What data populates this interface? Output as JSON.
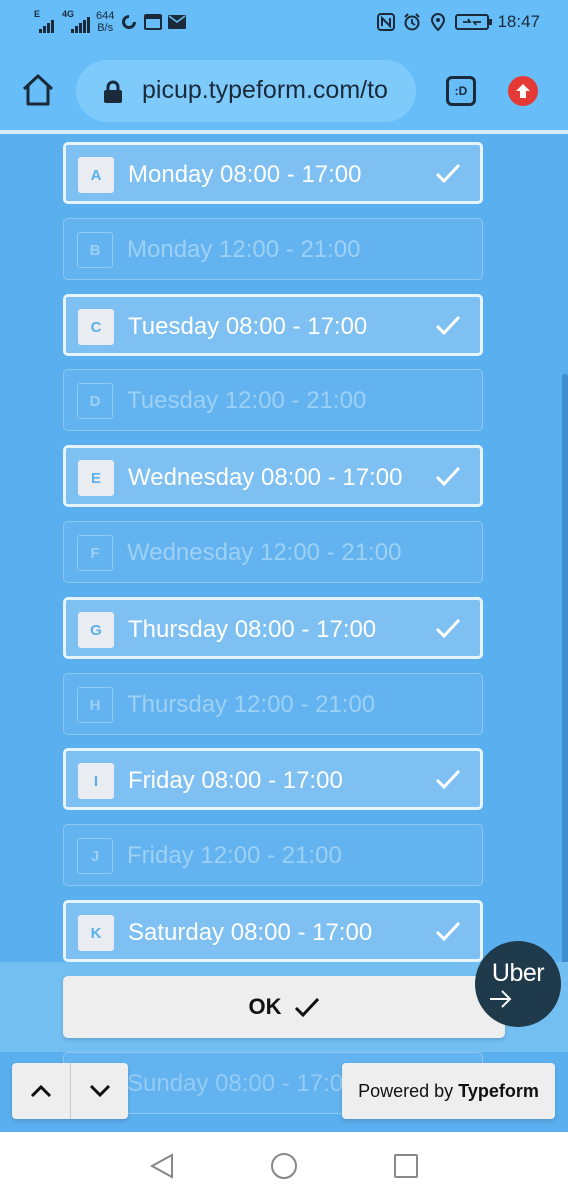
{
  "status_bar": {
    "signal_1": "E",
    "signal_2": "4G",
    "speed_value": "644",
    "speed_unit": "B/s",
    "time": "18:47",
    "icons": [
      "nfc-icon",
      "alarm-icon",
      "location-icon",
      "battery-charging-icon"
    ]
  },
  "browser": {
    "url": "picup.typeform.com/to",
    "tab_label": ":D",
    "icons": [
      "home-icon",
      "lock-icon",
      "tab-switcher-icon",
      "update-icon"
    ]
  },
  "choices": [
    {
      "key": "A",
      "label": "Monday 08:00 - 17:00",
      "selected": true
    },
    {
      "key": "B",
      "label": "Monday 12:00 - 21:00",
      "selected": false
    },
    {
      "key": "C",
      "label": "Tuesday 08:00 - 17:00",
      "selected": true
    },
    {
      "key": "D",
      "label": "Tuesday 12:00 - 21:00",
      "selected": false
    },
    {
      "key": "E",
      "label": "Wednesday 08:00 - 17:00",
      "selected": true
    },
    {
      "key": "F",
      "label": "Wednesday 12:00 - 21:00",
      "selected": false
    },
    {
      "key": "G",
      "label": "Thursday 08:00 - 17:00",
      "selected": true
    },
    {
      "key": "H",
      "label": "Thursday 12:00 - 21:00",
      "selected": false
    },
    {
      "key": "I",
      "label": "Friday 08:00 - 17:00",
      "selected": true
    },
    {
      "key": "J",
      "label": "Friday 12:00 - 21:00",
      "selected": false
    },
    {
      "key": "K",
      "label": "Saturday 08:00 - 17:00",
      "selected": true
    }
  ],
  "peek_choice": {
    "label": "Sunday 08:00 - 17:0"
  },
  "ok_button": {
    "label": "OK"
  },
  "uber_badge": {
    "label": "Uber"
  },
  "powered_by": {
    "prefix": "Powered by",
    "brand": "Typeform"
  },
  "colors": {
    "background": "#5aafef",
    "status_bar": "#66bdf8",
    "update_badge": "#e53935",
    "uber_badge": "#1f3a4a",
    "button_bg": "#eeeeee"
  }
}
